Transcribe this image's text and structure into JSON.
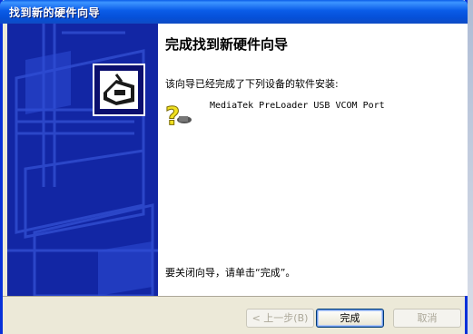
{
  "window": {
    "title": "找到新的硬件向导"
  },
  "wizard": {
    "heading": "完成找到新硬件向导",
    "intro": "该向导已经完成了下列设备的软件安装:",
    "device_name": "MediaTek PreLoader USB VCOM Port",
    "device_icon": "unknown-device-question-icon",
    "closing": "要关闭向导，请单击“完成”。"
  },
  "buttons": {
    "back_label": "< 上一步(B)",
    "finish_label": "完成",
    "cancel_label": "取消"
  },
  "colors": {
    "title_bar": "#0a5ce8",
    "left_panel": "#1428a8",
    "dialog_face": "#ece9d8"
  }
}
